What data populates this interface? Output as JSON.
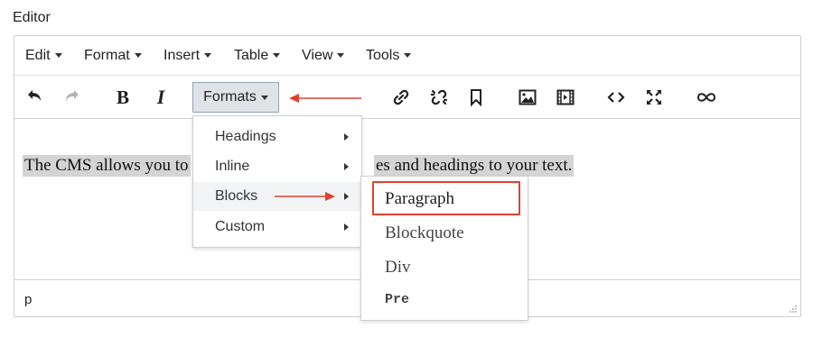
{
  "field_label": "Editor",
  "menubar": {
    "items": [
      {
        "label": "Edit"
      },
      {
        "label": "Format"
      },
      {
        "label": "Insert"
      },
      {
        "label": "Table"
      },
      {
        "label": "View"
      },
      {
        "label": "Tools"
      }
    ]
  },
  "toolbar": {
    "formats_label": "Formats",
    "buttons": [
      "undo-icon",
      "redo-icon",
      "bold-icon",
      "italic-icon",
      "link-icon",
      "unlink-icon",
      "bookmark-icon",
      "image-icon",
      "media-icon",
      "code-icon",
      "fullscreen-icon",
      "infinity-icon"
    ],
    "bold_glyph": "B",
    "italic_glyph": "I"
  },
  "content": {
    "text_before": "The CMS allows you to",
    "text_after": "es and headings to your text."
  },
  "statusbar": {
    "path": "p"
  },
  "formats_menu": {
    "items": [
      {
        "label": "Headings"
      },
      {
        "label": "Inline"
      },
      {
        "label": "Blocks"
      },
      {
        "label": "Custom"
      }
    ]
  },
  "blocks_submenu": {
    "items": [
      {
        "label": "Paragraph"
      },
      {
        "label": "Blockquote"
      },
      {
        "label": "Div"
      },
      {
        "label": "Pre"
      }
    ]
  },
  "colors": {
    "annotation": "#e2402e",
    "formats_active_bg": "#dfe3e7",
    "selection_bg": "#d4d4d4"
  }
}
